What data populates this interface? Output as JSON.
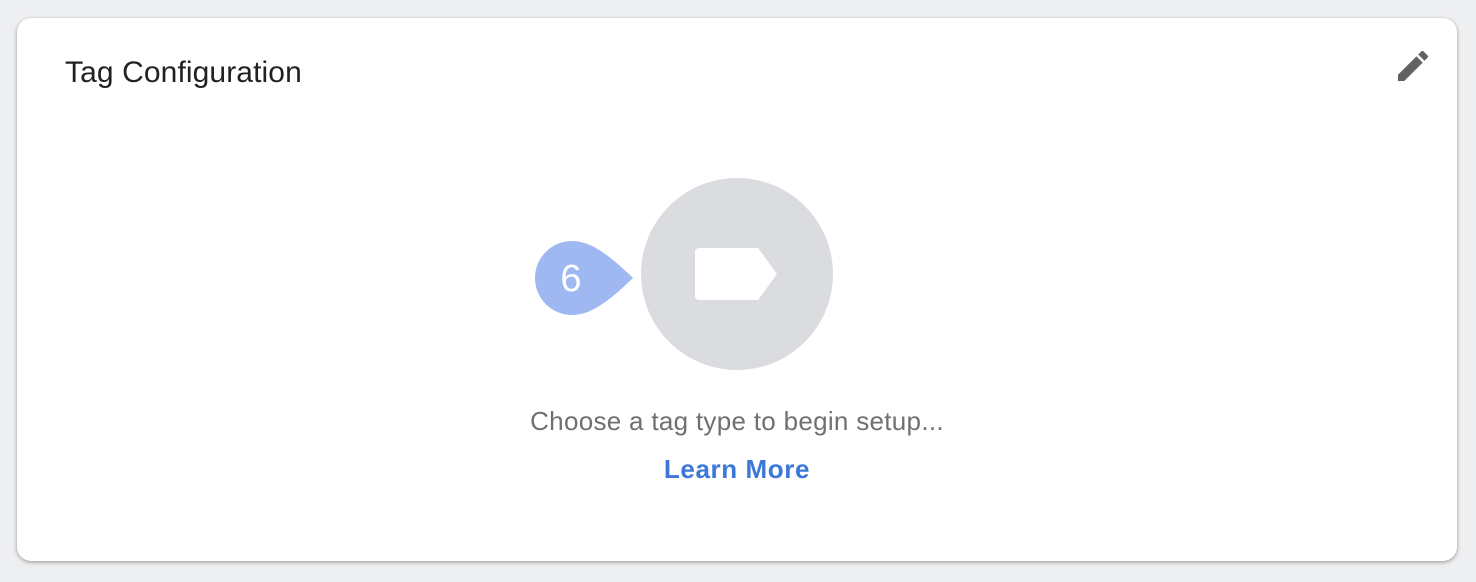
{
  "card": {
    "title": "Tag Configuration",
    "edit_icon": "pencil-icon"
  },
  "placeholder": {
    "icon": "tag-icon",
    "message": "Choose a tag type to begin setup...",
    "link_label": "Learn More"
  },
  "step_marker": {
    "number": "6"
  },
  "colors": {
    "title": "#202124",
    "circle": "#dadce0",
    "marker": "#a0b8f2",
    "link": "#3c78d8",
    "message": "#6e7073"
  }
}
